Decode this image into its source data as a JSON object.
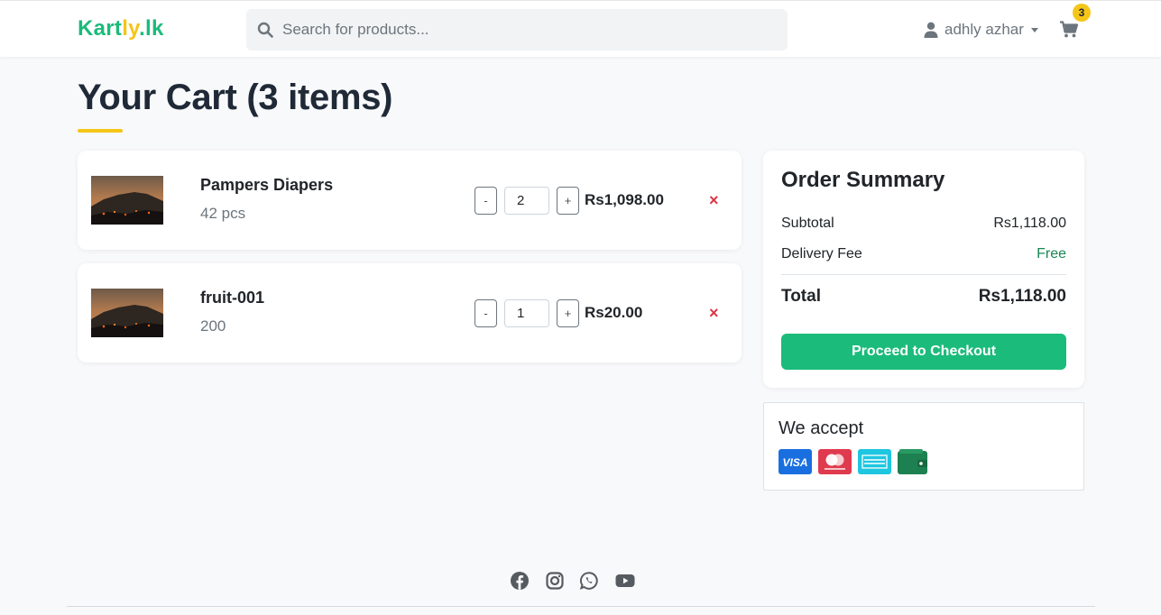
{
  "brand": {
    "logo_part1": "Kart",
    "logo_part2": "ly",
    "logo_part3": ".lk"
  },
  "search": {
    "placeholder": "Search for products..."
  },
  "user": {
    "name": "adhly azhar"
  },
  "cart_badge": "3",
  "page_title": "Your Cart (3 items)",
  "cart_items": [
    {
      "name": "Pampers Diapers",
      "subtitle": "42 pcs",
      "quantity": "2",
      "price": "Rs1,098.00",
      "minus": "-",
      "plus": "+",
      "remove": "×"
    },
    {
      "name": "fruit-001",
      "subtitle": "200",
      "quantity": "1",
      "price": "Rs20.00",
      "minus": "-",
      "plus": "+",
      "remove": "×"
    }
  ],
  "summary": {
    "title": "Order Summary",
    "subtotal_label": "Subtotal",
    "subtotal_value": "Rs1,118.00",
    "delivery_label": "Delivery Fee",
    "delivery_value": "Free",
    "total_label": "Total",
    "total_value": "Rs1,118.00",
    "checkout_label": "Proceed to Checkout"
  },
  "payment": {
    "title": "We accept",
    "methods": [
      "visa-icon",
      "mastercard-icon",
      "amex-icon",
      "wallet-icon"
    ],
    "visa_text": "VISA"
  },
  "footer": {
    "social": [
      "facebook-icon",
      "instagram-icon",
      "whatsapp-icon",
      "youtube-icon"
    ]
  },
  "colors": {
    "brand_green": "#1bbb7b",
    "brand_yellow": "#f5c518",
    "danger": "#dc3545",
    "success_text": "#198754"
  }
}
